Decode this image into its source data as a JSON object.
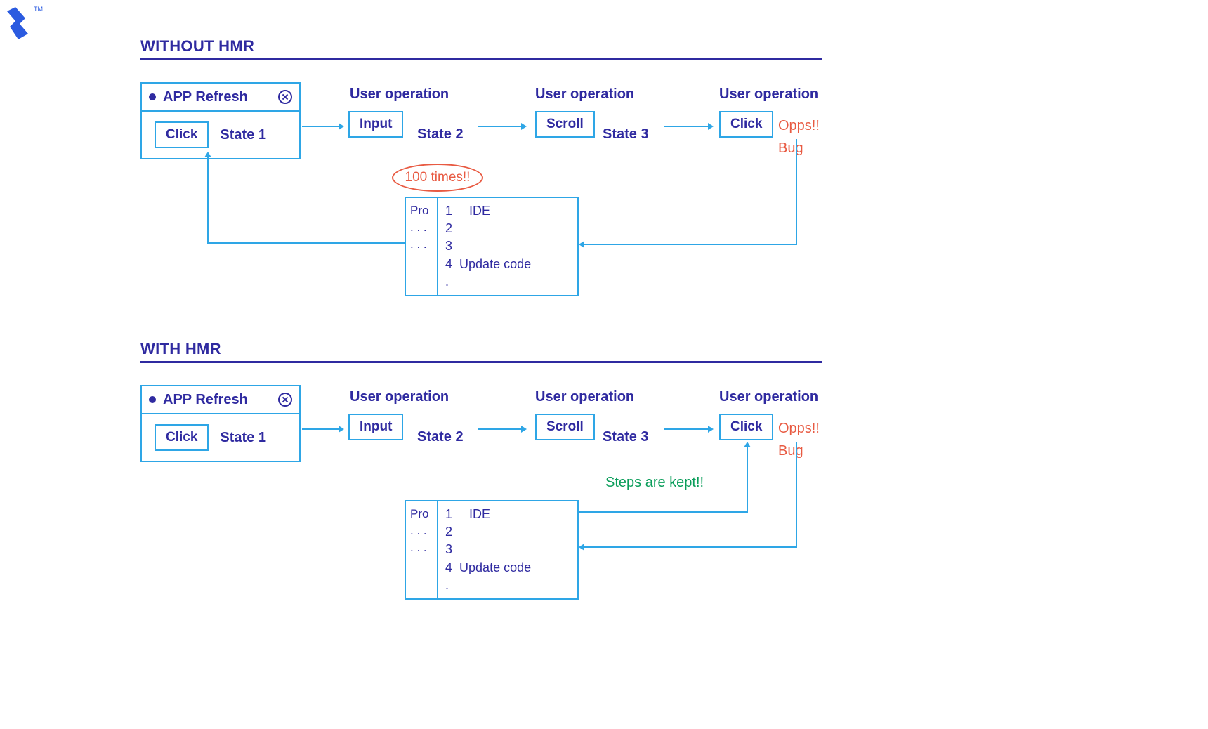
{
  "logo_tm": "TM",
  "section1": {
    "title": "WITHOUT HMR",
    "window": {
      "title": "APP Refresh",
      "button": "Click",
      "state": "State 1"
    },
    "op_label": "User operation",
    "step2": {
      "action": "Input",
      "state": "State 2"
    },
    "step3": {
      "action": "Scroll",
      "state": "State 3"
    },
    "step4": {
      "action": "Click"
    },
    "bug1": "Opps!!",
    "bug2": "Bug",
    "callout": "100 times!!",
    "ide": {
      "side1": "Pro",
      "side2": ". . .",
      "side3": ". . .",
      "lines": {
        "l1": "1",
        "l2": "2",
        "l3": "3",
        "l4": "4",
        "l5": ".",
        "title": "IDE",
        "body": "Update code"
      }
    }
  },
  "section2": {
    "title": "WITH HMR",
    "window": {
      "title": "APP Refresh",
      "button": "Click",
      "state": "State 1"
    },
    "op_label": "User operation",
    "step2": {
      "action": "Input",
      "state": "State 2"
    },
    "step3": {
      "action": "Scroll",
      "state": "State 3"
    },
    "step4": {
      "action": "Click"
    },
    "bug1": "Opps!!",
    "bug2": "Bug",
    "kept": "Steps are kept!!",
    "ide": {
      "side1": "Pro",
      "side2": ". . .",
      "side3": ". . .",
      "lines": {
        "l1": "1",
        "l2": "2",
        "l3": "3",
        "l4": "4",
        "l5": ".",
        "title": "IDE",
        "body": "Update code"
      }
    }
  }
}
